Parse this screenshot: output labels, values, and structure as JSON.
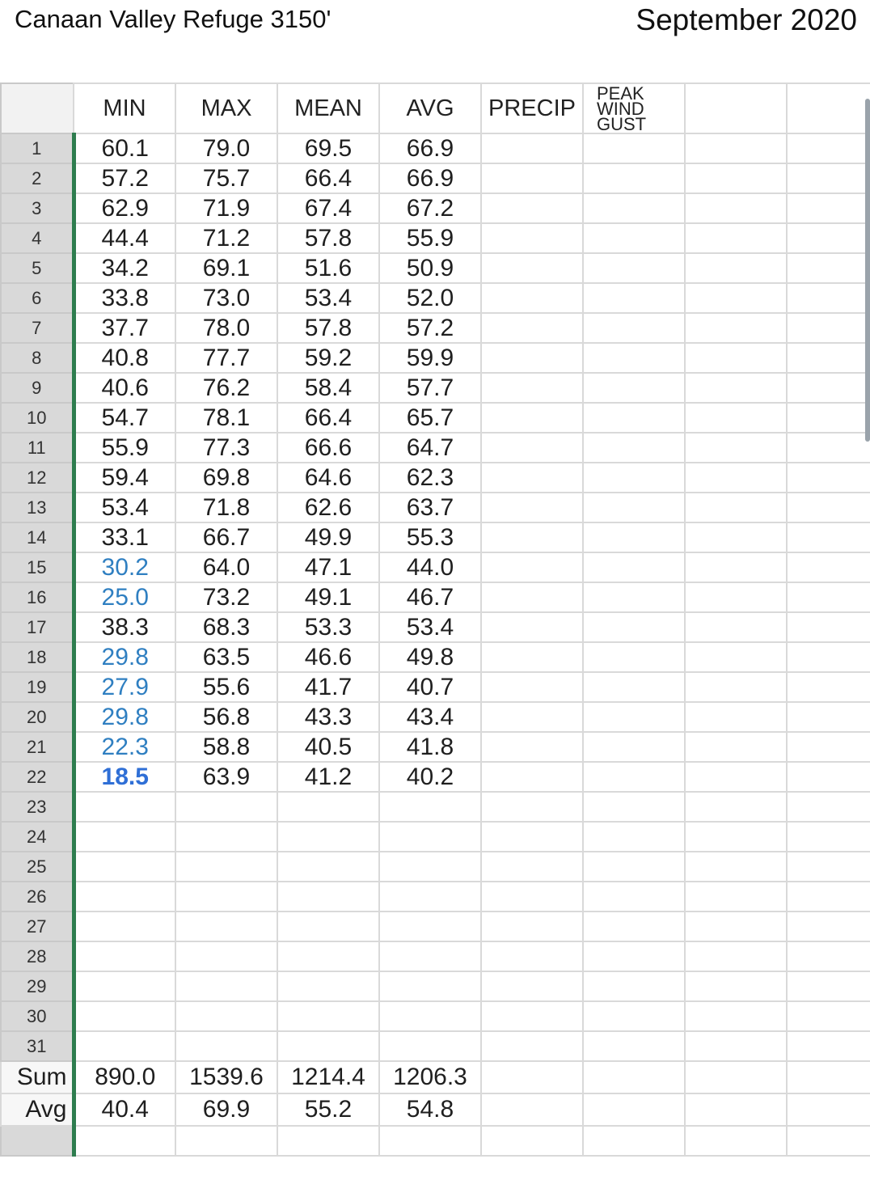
{
  "title": {
    "station": "Canaan Valley Refuge 3150'",
    "month": "September 2020"
  },
  "headers": {
    "min": "MIN",
    "max": "MAX",
    "mean": "MEAN",
    "avg": "AVG",
    "precip": "PRECIP",
    "peak_line1": "PEAK",
    "peak_line2": "WIND",
    "peak_line3": "GUST"
  },
  "rows": [
    {
      "n": "1",
      "min": "60.1",
      "max": "79.0",
      "mean": "69.5",
      "avg": "66.9"
    },
    {
      "n": "2",
      "min": "57.2",
      "max": "75.7",
      "mean": "66.4",
      "avg": "66.9"
    },
    {
      "n": "3",
      "min": "62.9",
      "max": "71.9",
      "mean": "67.4",
      "avg": "67.2"
    },
    {
      "n": "4",
      "min": "44.4",
      "max": "71.2",
      "mean": "57.8",
      "avg": "55.9"
    },
    {
      "n": "5",
      "min": "34.2",
      "max": "69.1",
      "mean": "51.6",
      "avg": "50.9"
    },
    {
      "n": "6",
      "min": "33.8",
      "max": "73.0",
      "mean": "53.4",
      "avg": "52.0"
    },
    {
      "n": "7",
      "min": "37.7",
      "max": "78.0",
      "mean": "57.8",
      "avg": "57.2"
    },
    {
      "n": "8",
      "min": "40.8",
      "max": "77.7",
      "mean": "59.2",
      "avg": "59.9"
    },
    {
      "n": "9",
      "min": "40.6",
      "max": "76.2",
      "mean": "58.4",
      "avg": "57.7"
    },
    {
      "n": "10",
      "min": "54.7",
      "max": "78.1",
      "mean": "66.4",
      "avg": "65.7"
    },
    {
      "n": "11",
      "min": "55.9",
      "max": "77.3",
      "mean": "66.6",
      "avg": "64.7"
    },
    {
      "n": "12",
      "min": "59.4",
      "max": "69.8",
      "mean": "64.6",
      "avg": "62.3"
    },
    {
      "n": "13",
      "min": "53.4",
      "max": "71.8",
      "mean": "62.6",
      "avg": "63.7"
    },
    {
      "n": "14",
      "min": "33.1",
      "max": "66.7",
      "mean": "49.9",
      "avg": "55.3"
    },
    {
      "n": "15",
      "min": "30.2",
      "max": "64.0",
      "mean": "47.1",
      "avg": "44.0"
    },
    {
      "n": "16",
      "min": "25.0",
      "max": "73.2",
      "mean": "49.1",
      "avg": "46.7"
    },
    {
      "n": "17",
      "min": "38.3",
      "max": "68.3",
      "mean": "53.3",
      "avg": "53.4"
    },
    {
      "n": "18",
      "min": "29.8",
      "max": "63.5",
      "mean": "46.6",
      "avg": "49.8"
    },
    {
      "n": "19",
      "min": "27.9",
      "max": "55.6",
      "mean": "41.7",
      "avg": "40.7"
    },
    {
      "n": "20",
      "min": "29.8",
      "max": "56.8",
      "mean": "43.3",
      "avg": "43.4"
    },
    {
      "n": "21",
      "min": "22.3",
      "max": "58.8",
      "mean": "40.5",
      "avg": "41.8"
    },
    {
      "n": "22",
      "min": "18.5",
      "max": "63.9",
      "mean": "41.2",
      "avg": "40.2"
    },
    {
      "n": "23",
      "min": "",
      "max": "",
      "mean": "",
      "avg": ""
    },
    {
      "n": "24",
      "min": "",
      "max": "",
      "mean": "",
      "avg": ""
    },
    {
      "n": "25",
      "min": "",
      "max": "",
      "mean": "",
      "avg": ""
    },
    {
      "n": "26",
      "min": "",
      "max": "",
      "mean": "",
      "avg": ""
    },
    {
      "n": "27",
      "min": "",
      "max": "",
      "mean": "",
      "avg": ""
    },
    {
      "n": "28",
      "min": "",
      "max": "",
      "mean": "",
      "avg": ""
    },
    {
      "n": "29",
      "min": "",
      "max": "",
      "mean": "",
      "avg": ""
    },
    {
      "n": "30",
      "min": "",
      "max": "",
      "mean": "",
      "avg": ""
    },
    {
      "n": "31",
      "min": "",
      "max": "",
      "mean": "",
      "avg": ""
    }
  ],
  "sum": {
    "label": "Sum",
    "min": "890.0",
    "max": "1539.6",
    "mean": "1214.4",
    "avg": "1206.3"
  },
  "avg_row": {
    "label": "Avg",
    "min": "40.4",
    "max": "69.9",
    "mean": "55.2",
    "avg": "54.8"
  },
  "colors": {
    "cold_text": "#2f7fc1",
    "coldest_text": "#2f6fd6",
    "row_header_bg": "#d9d9d9",
    "freeze_line": "#2e7d4f",
    "gridline": "#d9d9d9"
  }
}
